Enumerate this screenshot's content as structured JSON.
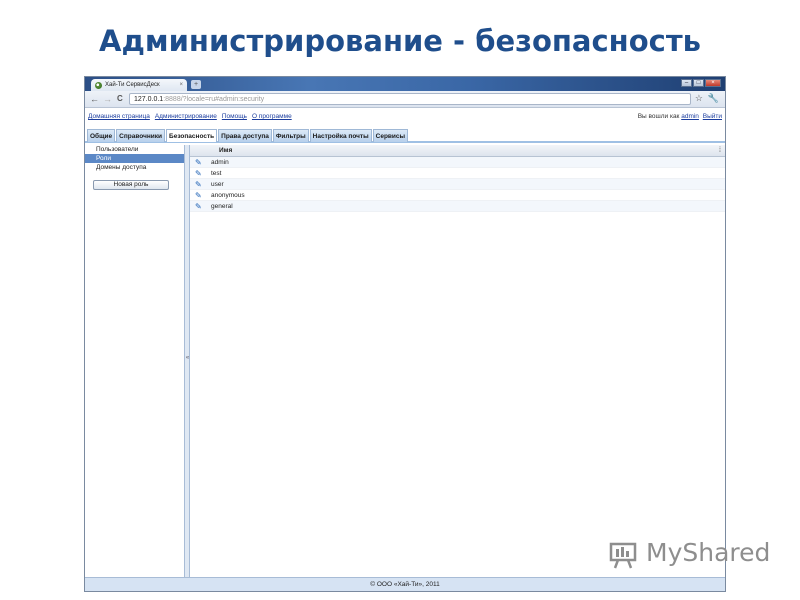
{
  "slide": {
    "title": "Администрирование - безопасность"
  },
  "browser": {
    "tab_title": "Хай-Ти СервисДеск",
    "tab_close": "×",
    "new_tab": "+",
    "window_buttons": [
      "–",
      "□",
      "×"
    ],
    "nav": {
      "back": "←",
      "forward": "→",
      "reload": "C"
    },
    "url_host": "127.0.0.1",
    "url_rest": ":8888/?locale=ru#admin:security",
    "star_icon": "☆",
    "wrench_icon": "🔧"
  },
  "app_menu": {
    "links": [
      "Домашняя страница",
      "Администрирование",
      "Помощь",
      "О программе"
    ],
    "logged_in_prefix": "Вы вошли как",
    "user": "admin",
    "logout": "Выйти"
  },
  "app_tabs": [
    {
      "label": "Общие",
      "active": false
    },
    {
      "label": "Справочники",
      "active": false
    },
    {
      "label": "Безопасность",
      "active": true
    },
    {
      "label": "Права доступа",
      "active": false
    },
    {
      "label": "Фильтры",
      "active": false
    },
    {
      "label": "Настройка почты",
      "active": false
    },
    {
      "label": "Сервисы",
      "active": false
    }
  ],
  "sidebar": {
    "items": [
      {
        "label": "Пользователи",
        "selected": false
      },
      {
        "label": "Роли",
        "selected": true
      },
      {
        "label": "Домены доступа",
        "selected": false
      }
    ],
    "new_role_button": "Новая роль"
  },
  "splitter_grip": "«",
  "grid": {
    "column_name": "Имя",
    "column_menu": "⁞",
    "edit_icon": "✎",
    "rows": [
      "admin",
      "test",
      "user",
      "anonymous",
      "general"
    ]
  },
  "footer": {
    "copyright": "© ООО «Хай-Ти», 2011"
  },
  "watermark": {
    "text": "MyShared"
  },
  "colors": {
    "title": "#1f4e8c",
    "selection": "#5b88c6",
    "link": "#1a3c9e"
  }
}
